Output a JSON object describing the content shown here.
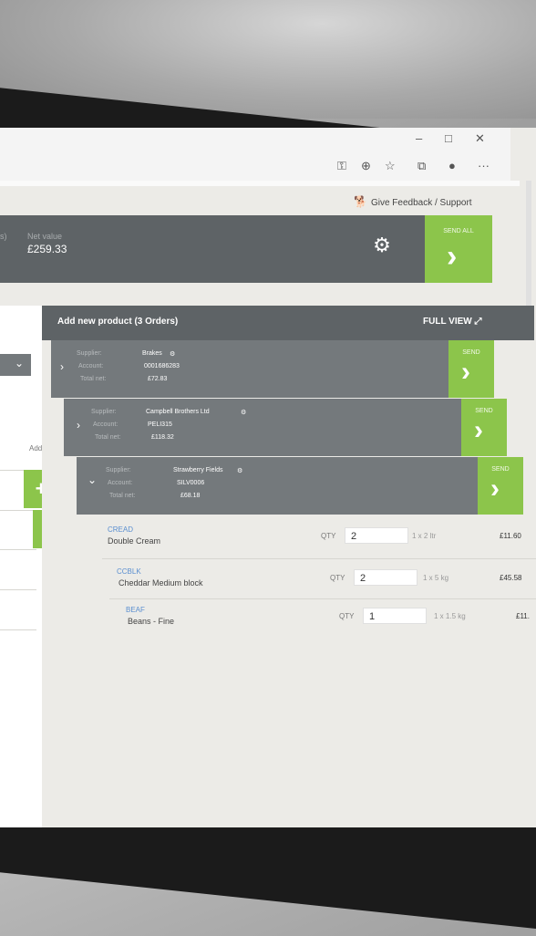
{
  "window": {
    "minimize": "–",
    "maximize": "□",
    "close": "✕"
  },
  "toolbar": {
    "more": "···"
  },
  "feedback": {
    "label": "Give Feedback / Support"
  },
  "summary": {
    "count_suffix": "s)",
    "net_label": "Net value",
    "net_value": "£259.33",
    "send_all": "SEND ALL"
  },
  "left": {
    "add_header": "Add"
  },
  "panel": {
    "title": "Add new product (3 Orders)",
    "full_view": "FULL VIEW",
    "orders": [
      {
        "supplier_label": "Supplier:",
        "supplier": "Brakes",
        "account_label": "Account:",
        "account": "0001686283",
        "total_label": "Total net:",
        "total": "£72.83",
        "send": "SEND"
      },
      {
        "supplier_label": "Supplier:",
        "supplier": "Campbell Brothers Ltd",
        "account_label": "Account:",
        "account": "PELI315",
        "total_label": "Total net:",
        "total": "£118.32",
        "send": "SEND"
      },
      {
        "supplier_label": "Supplier:",
        "supplier": "Strawberry Fields",
        "account_label": "Account:",
        "account": "SILV0006",
        "total_label": "Total net:",
        "total": "£68.18",
        "send": "SEND"
      }
    ],
    "products": [
      {
        "code": "CREAD",
        "name": "Double Cream",
        "qty_label": "QTY",
        "qty": "2",
        "size": "1 x 2 ltr",
        "price": "£11.60"
      },
      {
        "code": "CCBLK",
        "name": "Cheddar Medium block",
        "qty_label": "QTY",
        "qty": "2",
        "size": "1 x 5 kg",
        "price": "£45.58"
      },
      {
        "code": "BEAF",
        "name": "Beans - Fine",
        "qty_label": "QTY",
        "qty": "1",
        "size": "1 x 1.5 kg",
        "price": "£11."
      }
    ]
  }
}
